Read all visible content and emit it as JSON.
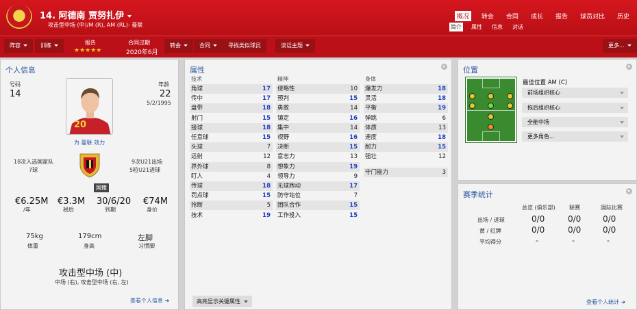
{
  "header": {
    "title": "14. 阿德南 贾努扎伊",
    "subtitle": "攻击型中场 (中)/M (R), AM (RL)- 曼联"
  },
  "nav": [
    "概况",
    "转会",
    "合同",
    "成长",
    "报告",
    "球员对比",
    "历史"
  ],
  "subnav": [
    "简介",
    "属性",
    "信息",
    "对话"
  ],
  "toolbar": {
    "squad": "阵容",
    "training": "训练",
    "report_label": "报告",
    "stars": "★★★★★",
    "contract_label": "合同过期",
    "contract_value": "2020年6月",
    "transfer": "转会",
    "contract": "合同",
    "find_similar": "寻找类似球员",
    "talk": "谈话主题",
    "more": "更多..."
  },
  "personal": {
    "title": "个人信息",
    "number_label": "号码",
    "number": "14",
    "age_label": "年龄",
    "age": "22",
    "dob": "5/2/1995",
    "appearances_text": "为 曼联 效力",
    "caps_left": "18次入选国家队",
    "goals_left": "7球",
    "caps_right": "9次U21出场",
    "goals_right": "5粒U21进球",
    "nationality": "国籍",
    "money": [
      {
        "value": "€6.25M",
        "label": "/年"
      },
      {
        "value": "€3.3M",
        "label": "税后"
      },
      {
        "value": "30/6/20",
        "label": "到期"
      },
      {
        "value": "€74M",
        "label": "身价"
      }
    ],
    "physical": [
      {
        "value": "75kg",
        "label": "体重"
      },
      {
        "value": "179cm",
        "label": "身高"
      },
      {
        "value": "左脚",
        "label": "习惯脚"
      }
    ],
    "position_main": "攻击型中场 (中)",
    "position_sub": "中场 (右), 攻击型中场 (右, 左)",
    "link": "查看个人信息"
  },
  "attributes": {
    "title": "属性",
    "col_titles": [
      "技术",
      "精神",
      "身体"
    ],
    "technical": [
      [
        "角球",
        17
      ],
      [
        "传中",
        17
      ],
      [
        "盘带",
        18
      ],
      [
        "射门",
        15
      ],
      [
        "接球",
        18
      ],
      [
        "任意球",
        15
      ],
      [
        "头球",
        7
      ],
      [
        "远射",
        12
      ],
      [
        "界外球",
        8
      ],
      [
        "盯人",
        4
      ],
      [
        "传球",
        18
      ],
      [
        "罚点球",
        15
      ],
      [
        "抢断",
        5
      ],
      [
        "技术",
        19
      ]
    ],
    "mental": [
      [
        "侵略性",
        10
      ],
      [
        "预判",
        15
      ],
      [
        "勇敢",
        14
      ],
      [
        "镇定",
        16
      ],
      [
        "集中",
        14
      ],
      [
        "视野",
        16
      ],
      [
        "决断",
        15
      ],
      [
        "意志力",
        13
      ],
      [
        "想象力",
        19
      ],
      [
        "领导力",
        9
      ],
      [
        "无球跑动",
        17
      ],
      [
        "防守站位",
        7
      ],
      [
        "团队合作",
        15
      ],
      [
        "工作投入",
        15
      ]
    ],
    "physical": [
      [
        "爆发力",
        18
      ],
      [
        "灵活",
        18
      ],
      [
        "平衡",
        19
      ],
      [
        "弹跳",
        6
      ],
      [
        "体质",
        13
      ],
      [
        "速度",
        18
      ],
      [
        "耐力",
        15
      ],
      [
        "强壮",
        12
      ]
    ],
    "gk": [
      [
        "守门能力",
        3
      ]
    ],
    "button": "高亮显示关键属性"
  },
  "position": {
    "title": "位置",
    "best_label": "最佳位置 AM (C)",
    "roles": [
      "前场组织核心",
      "拖后组织核心",
      "全能中场",
      "更多角色..."
    ]
  },
  "season": {
    "title": "赛季统计",
    "cols": [
      "总览 (俱乐部)",
      "联赛",
      "国际比赛"
    ],
    "rows": [
      {
        "label": "出场 / 进球",
        "vals": [
          "0/0",
          "0/0",
          "0/0"
        ]
      },
      {
        "label": "黄 / 红牌",
        "vals": [
          "0/0",
          "0/0",
          "0/0"
        ]
      },
      {
        "label": "平均得分",
        "vals": [
          "-",
          "-",
          "-"
        ]
      }
    ],
    "link": "查看个人统计"
  },
  "colors": {
    "header_red": "#c8141b",
    "title_blue": "#2d56a4"
  }
}
